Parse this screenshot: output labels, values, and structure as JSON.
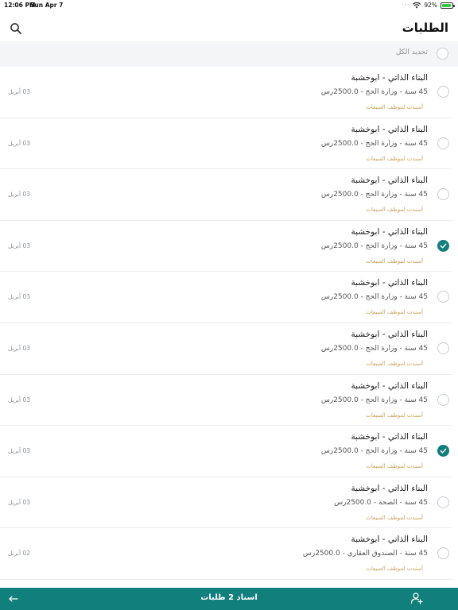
{
  "status_bar": {
    "time": "12:06 PM",
    "date": "Sun Apr 7",
    "battery": "92%",
    "battery_level": 0.92
  },
  "header": {
    "title": "الطلبات"
  },
  "select_all": {
    "label": "تحديد الكل"
  },
  "items": [
    {
      "title": "البناء الذاتي - ابوخشبة",
      "subtitle": "45 سنة - وزارة الحج - 2500.0رس",
      "status": "أسندت لموظف المبيعات",
      "date": "03 أبريل",
      "checked": false
    },
    {
      "title": "البناء الذاتي - ابوخشبة",
      "subtitle": "45 سنة - وزارة الحج - 2500.0رس",
      "status": "أسندت لموظف المبيعات",
      "date": "03 أبريل",
      "checked": false
    },
    {
      "title": "البناء الذاتي - ابوخشبة",
      "subtitle": "45 سنة - وزارة الحج - 2500.0رس",
      "status": "أسندت لموظف المبيعات",
      "date": "03 أبريل",
      "checked": false
    },
    {
      "title": "البناء الذاتي - ابوخشبة",
      "subtitle": "45 سنة - وزارة الحج - 2500.0رس",
      "status": "أسندت لموظف المبيعات",
      "date": "03 أبريل",
      "checked": true
    },
    {
      "title": "البناء الذاتي - ابوخشبة",
      "subtitle": "45 سنة - وزارة الحج - 2500.0رس",
      "status": "أسندت لموظف المبيعات",
      "date": "03 أبريل",
      "checked": false
    },
    {
      "title": "البناء الذاتي - ابوخشبة",
      "subtitle": "45 سنة - وزارة الحج - 2500.0رس",
      "status": "أسندت لموظف المبيعات",
      "date": "03 أبريل",
      "checked": false
    },
    {
      "title": "البناء الذاتي - ابوخشبة",
      "subtitle": "45 سنة - وزارة الحج - 2500.0رس",
      "status": "أسندت لموظف المبيعات",
      "date": "03 أبريل",
      "checked": false
    },
    {
      "title": "البناء الذاتي - ابوخشبة",
      "subtitle": "45 سنة - وزارة الحج - 2500.0رس",
      "status": "أسندت لموظف المبيعات",
      "date": "03 أبريل",
      "checked": true
    },
    {
      "title": "البناء الذاتي - ابوخشبة",
      "subtitle": "45 سنة - الصحة - 2500.0رس",
      "status": "أسندت لموظف المبيعات",
      "date": "03 أبريل",
      "checked": false
    },
    {
      "title": "البناء الذاتي - ابوخشبة",
      "subtitle": "45 سنة - الصندوق العقاري - 2500.0رس",
      "status": "أسندت لموظف المبيعات",
      "date": "02 أبريل",
      "checked": false
    }
  ],
  "bottom_bar": {
    "label": "اسناد 2 طلبات",
    "add_icon": "add-user-icon",
    "back_icon": "arrow-left-icon"
  },
  "colors": {
    "accent": "#117f7b",
    "status_text": "#c7a35d",
    "select_bg": "#f4f5f6"
  }
}
